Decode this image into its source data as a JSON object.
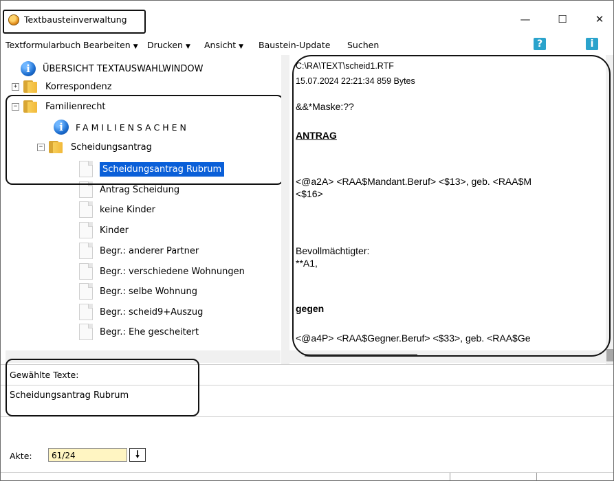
{
  "window": {
    "title": "Textbausteinverwaltung",
    "minimize": "—",
    "maximize": "☐",
    "close": "✕"
  },
  "menu": {
    "items": [
      {
        "label": "Textformularbuch",
        "arrow": ""
      },
      {
        "label": "Bearbeiten",
        "arrow": "▼"
      },
      {
        "label": "Drucken",
        "arrow": "▼"
      },
      {
        "label": "Ansicht",
        "arrow": "▼"
      },
      {
        "label": "Baustein-Update",
        "arrow": ""
      },
      {
        "label": "Suchen",
        "arrow": ""
      }
    ],
    "help": "?",
    "info": "i"
  },
  "tree": {
    "items": [
      {
        "label": "ÜBERSICHT TEXTAUSWAHLWINDOW",
        "icon": "info-icon"
      },
      {
        "label": "Korrespondenz",
        "icon": "folder-icon",
        "expander": "+"
      },
      {
        "label": "Familienrecht",
        "icon": "folder-icon",
        "expander": "−"
      },
      {
        "label": "FAMILIENSACHEN",
        "icon": "info-icon"
      },
      {
        "label": "Scheidungsantrag",
        "icon": "folder-icon",
        "expander": "−"
      },
      {
        "label": "Scheidungsantrag Rubrum",
        "icon": "document-icon",
        "selected": true
      },
      {
        "label": "Antrag Scheidung",
        "icon": "document-icon"
      },
      {
        "label": "keine Kinder",
        "icon": "document-icon"
      },
      {
        "label": "Kinder",
        "icon": "document-icon"
      },
      {
        "label": "Begr.: anderer Partner",
        "icon": "document-icon"
      },
      {
        "label": "Begr.: verschiedene Wohnungen",
        "icon": "document-icon"
      },
      {
        "label": "Begr.: selbe Wohnung",
        "icon": "document-icon"
      },
      {
        "label": "Begr.: scheid9+Auszug",
        "icon": "document-icon"
      },
      {
        "label": "Begr.: Ehe gescheitert",
        "icon": "document-icon"
      }
    ]
  },
  "preview": {
    "path": "C:\\RA\\TEXT\\scheid1.RTF",
    "meta": "15.07.2024 22:21:34  859 Bytes",
    "line1": "&&*Maske:??",
    "heading": "ANTRAG",
    "line2": "<@a2A>  <RAA$Mandant.Beruf>  <$13>, geb. <RAA$M",
    "line3": "<$16>",
    "line4": "Bevollmächtigter:",
    "line5": "**A1,",
    "gegen": "gegen",
    "line6": "<@a4P> <RAA$Gegner.Beruf>  <$33>, geb. <RAA$Ge"
  },
  "selection": {
    "label": "Gewählte Texte:",
    "value": "Scheidungsantrag Rubrum"
  },
  "akte": {
    "label": "Akte:",
    "value": "61/24",
    "button": "🠗"
  },
  "buttons": {
    "ok": "✓",
    "cancel": "✕"
  },
  "colors": {
    "selection": "#0a5fd8",
    "akte_field": "#fff5c2",
    "help_button": "#2aa3cc"
  }
}
